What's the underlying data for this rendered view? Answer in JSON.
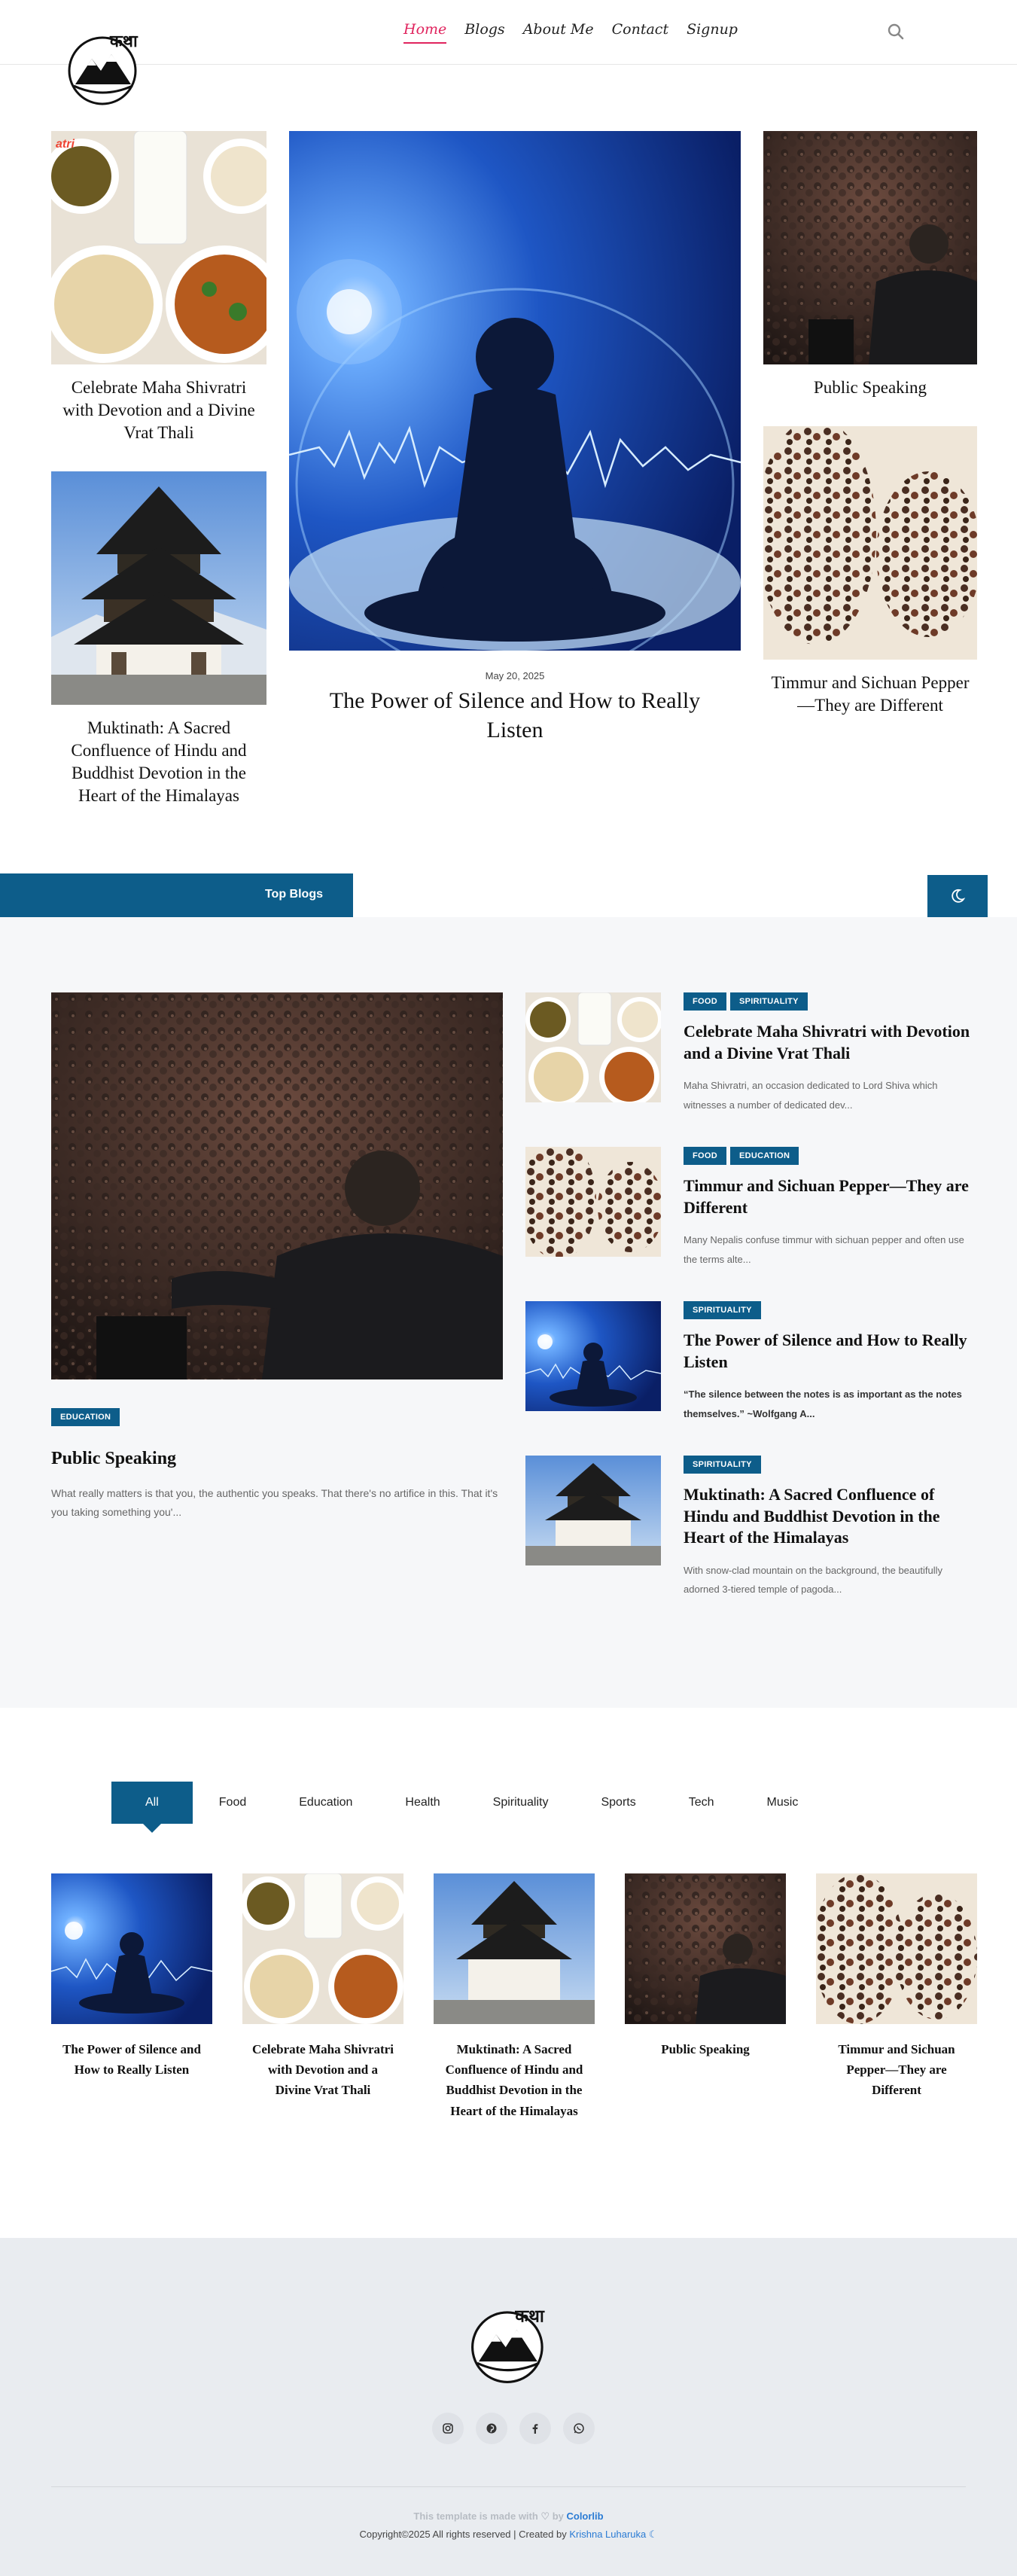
{
  "header": {
    "nav": [
      "Home",
      "Blogs",
      "About Me",
      "Contact",
      "Signup"
    ],
    "logo_text": "कथा"
  },
  "hero": {
    "left_top_title": "Celebrate Maha Shivratri with Devotion and a Divine Vrat Thali",
    "left_bottom_title": "Muktinath: A Sacred Confluence of Hindu and Buddhist Devotion in the Heart of the Himalayas",
    "center_date": "May 20, 2025",
    "center_title": "The Power of Silence and How to Really Listen",
    "right_top_title": "Public Speaking",
    "right_bottom_title": "Timmur and Sichuan Pepper—They are Different"
  },
  "top_blogs": {
    "label": "Top Blogs",
    "featured": {
      "badge": "EDUCATION",
      "title": "Public Speaking",
      "excerpt": "What really matters is that you, the authentic you speaks. That there's no artifice in this. That it's you taking something you'..."
    },
    "items": [
      {
        "badges": [
          "FOOD",
          "SPIRITUALITY"
        ],
        "title": "Celebrate Maha Shivratri with Devotion and a Divine Vrat Thali",
        "excerpt": "Maha Shivratri, an occasion dedicated to Lord Shiva which witnesses a number of dedicated dev..."
      },
      {
        "badges": [
          "FOOD",
          "EDUCATION"
        ],
        "title": "Timmur and Sichuan Pepper—They are Different",
        "excerpt": "Many Nepalis confuse timmur with sichuan pepper and often use the terms alte..."
      },
      {
        "badges": [
          "SPIRITUALITY"
        ],
        "title": "The Power of Silence and How to Really Listen",
        "excerpt": "“The silence between the notes is as important as the notes themselves.” ~Wolfgang A..."
      },
      {
        "badges": [
          "SPIRITUALITY"
        ],
        "title": "Muktinath: A Sacred Confluence of Hindu and Buddhist Devotion in the Heart of the Himalayas",
        "excerpt": "With snow-clad mountain on the background, the beautifully adorned 3-tiered temple of pagoda..."
      }
    ]
  },
  "filters": [
    "All",
    "Food",
    "Education",
    "Health",
    "Spirituality",
    "Sports",
    "Tech",
    "Music"
  ],
  "grid": [
    "The Power of Silence and How to Really Listen",
    "Celebrate Maha Shivratri with Devotion and a Divine Vrat Thali",
    "Muktinath: A Sacred Confluence of Hindu and Buddhist Devotion in the Heart of the Himalayas",
    "Public Speaking",
    "Timmur and Sichuan Pepper—They are Different"
  ],
  "footer": {
    "made_prefix": "This template is made with ♡ by ",
    "made_brand": "Colorlib",
    "copy_prefix": "Copyright©2025 All rights reserved | Created by ",
    "copy_author": "Krishna Luharuka",
    "social_icons": [
      "instagram-icon",
      "pinterest-icon",
      "facebook-icon",
      "whatsapp-icon"
    ]
  },
  "colors": {
    "accent": "#0d5d8a",
    "active_nav": "#e0245e",
    "link": "#2a7bd4"
  }
}
